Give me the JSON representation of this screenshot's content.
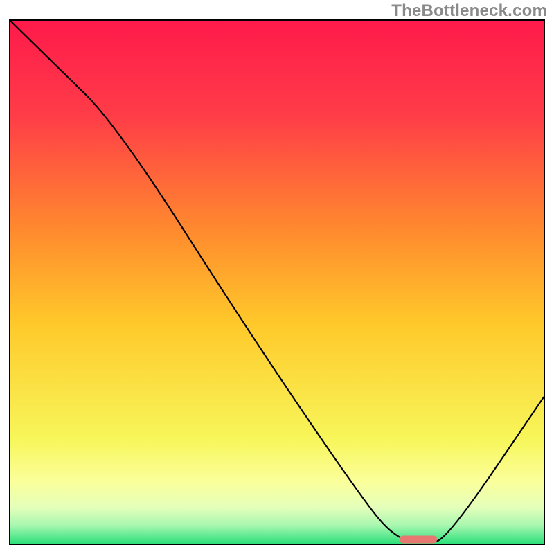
{
  "watermark": "TheBottleneck.com",
  "chart_data": {
    "type": "line",
    "title": "",
    "xlabel": "",
    "ylabel": "",
    "xlim": [
      0,
      100
    ],
    "ylim": [
      0,
      100
    ],
    "grid": false,
    "legend": false,
    "series": [
      {
        "name": "bottleneck-curve",
        "x": [
          0,
          8,
          20,
          45,
          65,
          72,
          78,
          82,
          100
        ],
        "y": [
          100,
          92,
          80,
          40,
          10,
          1,
          0,
          1,
          28
        ]
      }
    ],
    "marker": {
      "name": "optimal-range",
      "x_start": 73,
      "x_end": 80,
      "y": 0.8
    },
    "background_gradient": {
      "stops": [
        {
          "pos": 0.0,
          "color": "#ff1a4b"
        },
        {
          "pos": 0.18,
          "color": "#ff3c48"
        },
        {
          "pos": 0.4,
          "color": "#ff8a2e"
        },
        {
          "pos": 0.58,
          "color": "#ffc92a"
        },
        {
          "pos": 0.8,
          "color": "#f7f65a"
        },
        {
          "pos": 0.88,
          "color": "#fbff9a"
        },
        {
          "pos": 0.93,
          "color": "#e5ffba"
        },
        {
          "pos": 0.965,
          "color": "#a8f7b0"
        },
        {
          "pos": 1.0,
          "color": "#2de07a"
        }
      ]
    }
  }
}
